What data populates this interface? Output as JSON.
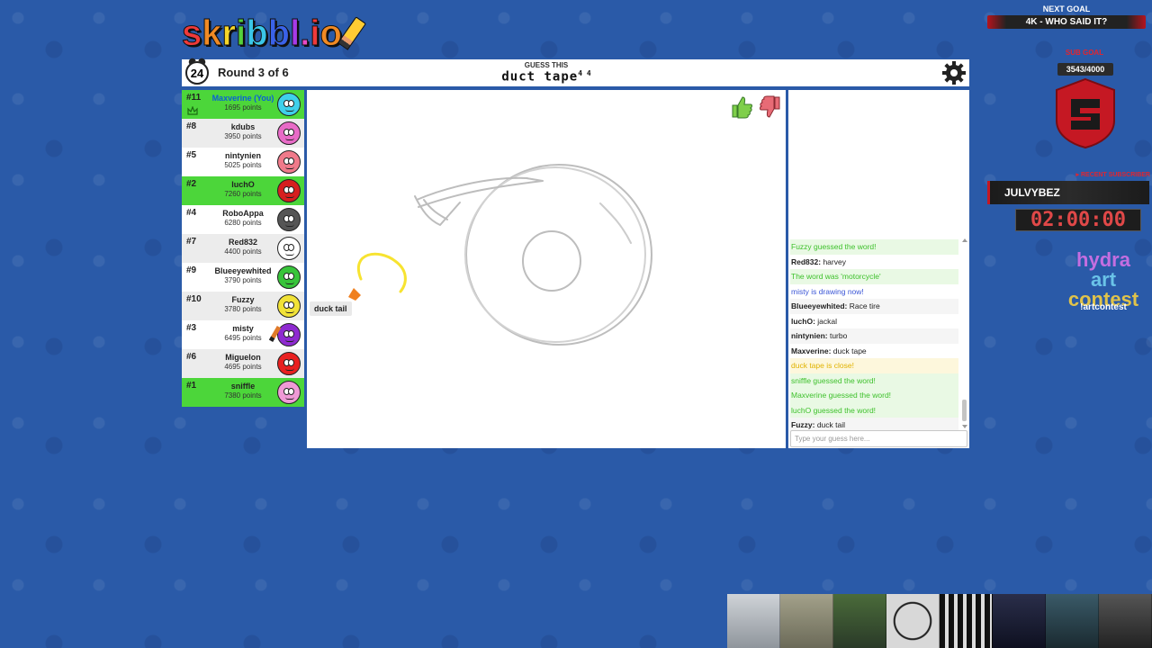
{
  "logo": {
    "text": "skribbl.io"
  },
  "header": {
    "timer": "24",
    "round": "Round 3 of 6",
    "guess_label": "GUESS THIS",
    "word_hint": "duct tape",
    "word_hint_superscript": "4 4"
  },
  "players": [
    {
      "rank": "#11",
      "name": "Maxverine (You)",
      "points": "1695 points",
      "guessed": true,
      "you": true,
      "avatar_color": "#3fd0ea"
    },
    {
      "rank": "#8",
      "name": "kdubs",
      "points": "3950 points",
      "guessed": false,
      "avatar_color": "#e86bc7"
    },
    {
      "rank": "#5",
      "name": "nintynien",
      "points": "5025 points",
      "guessed": false,
      "avatar_color": "#f07a8a"
    },
    {
      "rank": "#2",
      "name": "luchO",
      "points": "7260 points",
      "guessed": true,
      "avatar_color": "#d61f1f"
    },
    {
      "rank": "#4",
      "name": "RoboAppa",
      "points": "6280 points",
      "guessed": false,
      "avatar_color": "#555555"
    },
    {
      "rank": "#7",
      "name": "Red832",
      "points": "4400 points",
      "guessed": false,
      "avatar_color": "#ffffff"
    },
    {
      "rank": "#9",
      "name": "Blueeyewhited",
      "points": "3790 points",
      "guessed": false,
      "avatar_color": "#38c43a"
    },
    {
      "rank": "#10",
      "name": "Fuzzy",
      "points": "3780 points",
      "guessed": false,
      "avatar_color": "#f1e237"
    },
    {
      "rank": "#3",
      "name": "misty",
      "points": "6495 points",
      "guessed": false,
      "drawing": true,
      "avatar_color": "#8e2ad0"
    },
    {
      "rank": "#6",
      "name": "Miguelon",
      "points": "4695 points",
      "guessed": false,
      "avatar_color": "#e82020"
    },
    {
      "rank": "#1",
      "name": "sniffle",
      "points": "7380 points",
      "guessed": true,
      "avatar_color": "#ef9ad6"
    }
  ],
  "canvas": {
    "hover_label": "duck tail"
  },
  "chat": {
    "messages": [
      {
        "name": "",
        "text": "Fuzzy guessed the word!",
        "style": "green"
      },
      {
        "name": "Red832:",
        "text": " harvey",
        "style": ""
      },
      {
        "name": "",
        "text": "The word was 'motorcycle'",
        "style": "green"
      },
      {
        "name": "",
        "text": "misty is drawing now!",
        "style": "blue"
      },
      {
        "name": "Blueeyewhited:",
        "text": " Race tire",
        "style": ""
      },
      {
        "name": "luchO:",
        "text": " jackal",
        "style": ""
      },
      {
        "name": "nintynien:",
        "text": " turbo",
        "style": ""
      },
      {
        "name": "Maxverine:",
        "text": " duck tape",
        "style": ""
      },
      {
        "name": "",
        "text": "duck tape is close!",
        "style": "yellow"
      },
      {
        "name": "",
        "text": "sniffle guessed the word!",
        "style": "green"
      },
      {
        "name": "",
        "text": "Maxverine guessed the word!",
        "style": "green"
      },
      {
        "name": "",
        "text": "luchO guessed the word!",
        "style": "green"
      },
      {
        "name": "Fuzzy:",
        "text": " duck tail",
        "style": ""
      }
    ],
    "input_placeholder": "Type your guess here..."
  },
  "stream": {
    "next_goal_label": "NEXT GOAL",
    "next_goal_text": "4K - WHO SAID IT?",
    "sub_goal_label": "SUB GOAL",
    "sub_goal_count": "3543/4000",
    "recent_sub_label": "RECENT SUBSCRIBER",
    "recent_sub_name": "JULVYBEZ",
    "countdown": "02:00:00",
    "contest_words": [
      "hydra",
      "art",
      "contest"
    ],
    "contest_command": "!artcontest"
  },
  "colors": {
    "background": "#2a5aa8",
    "guessed": "#4cd63a",
    "chat_green": "#3ec12c",
    "chat_blue": "#3a55d6",
    "chat_yellow": "#e0b200",
    "accent_red": "#c51823"
  },
  "icons": {
    "timer": "alarm-clock-icon",
    "settings": "gear-icon",
    "like": "thumbs-up-icon",
    "dislike": "thumbs-down-icon",
    "crown": "crown-icon",
    "pencil": "pencil-icon"
  }
}
